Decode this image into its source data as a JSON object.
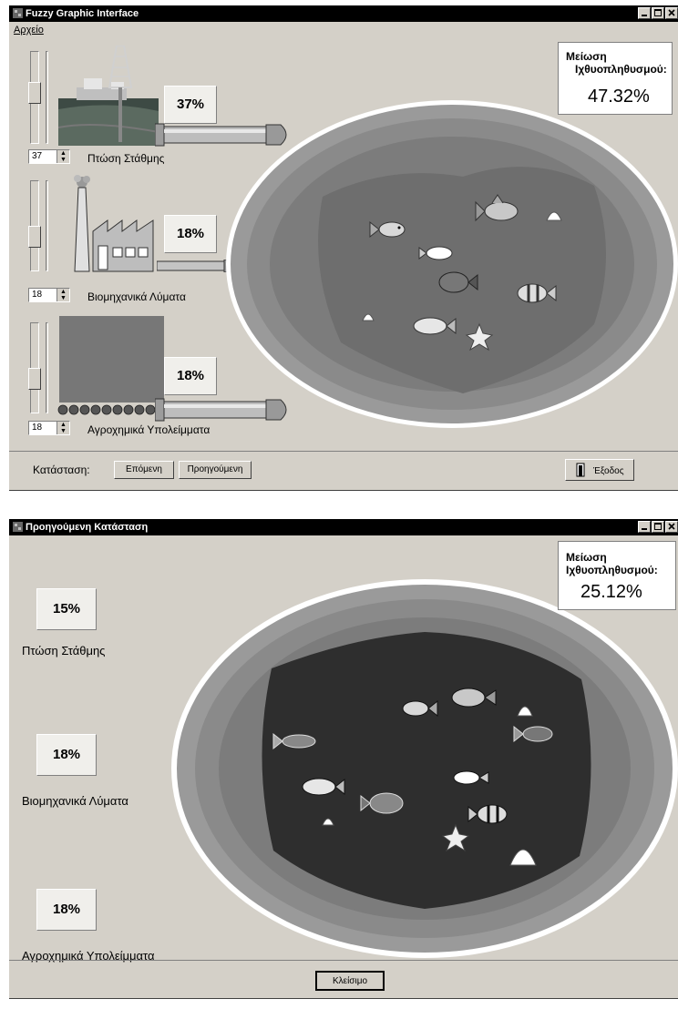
{
  "main": {
    "title": "Fuzzy Graphic Interface",
    "menu_file": "Αρχείο",
    "result_title_line1": "Μείωση",
    "result_title_line2": "Ιχθυοπληθυσμού:",
    "result_value": "47.32%",
    "factors": [
      {
        "label": "Πτώση Στάθμης",
        "percent": "37%",
        "spin_value": "37"
      },
      {
        "label": "Βιομηχανικά Λύματα",
        "percent": "18%",
        "spin_value": "18"
      },
      {
        "label": "Αγροχημικά Υπολείμματα",
        "percent": "18%",
        "spin_value": "18"
      }
    ],
    "status_label": "Κατάσταση:",
    "next_label": "Επόμενη",
    "prev_label": "Προηγούμενη",
    "exit_label": "Έξοδος"
  },
  "prev_window": {
    "title": "Προηγούμενη Κατάσταση",
    "result_title_line1": "Μείωση",
    "result_title_line2": "Ιχθυοπληθυσμού:",
    "result_value": "25.12%",
    "factors": [
      {
        "label": "Πτώση Στάθμης",
        "percent": "15%"
      },
      {
        "label": "Βιομηχανικά Λύματα",
        "percent": "18%"
      },
      {
        "label": "Αγροχημικά Υπολείμματα",
        "percent": "18%"
      }
    ],
    "close_label": "Κλείσιμο"
  },
  "colors": {
    "lake_water_main": "#6e6e6e",
    "lake_water_prev": "#2e2e2e",
    "titlebar": "#000000"
  },
  "icons": [
    "app-icon",
    "minimize-icon",
    "maximize-icon",
    "close-icon",
    "door-exit-icon"
  ]
}
